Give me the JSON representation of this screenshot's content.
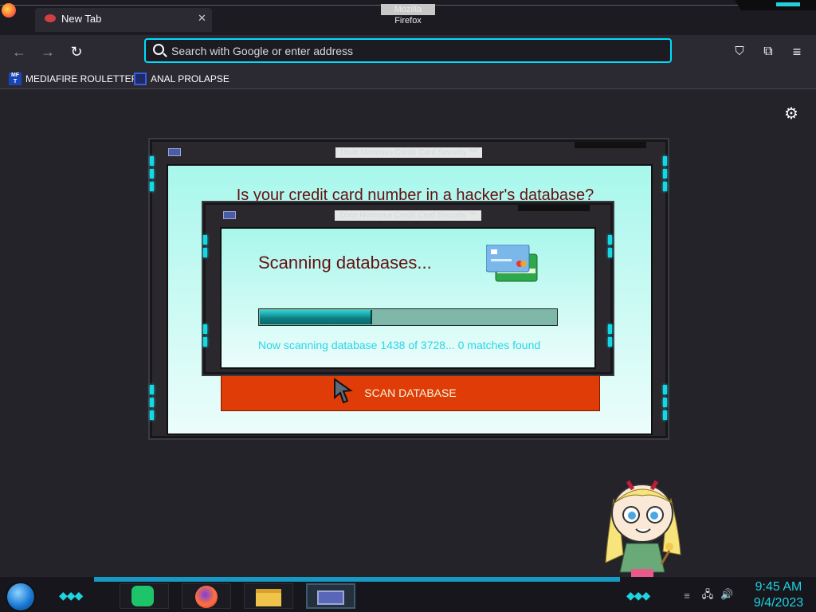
{
  "browser": {
    "window_title": "Mozilla Firefox",
    "tab_title": "New Tab",
    "url_placeholder": "Search with Google or enter address",
    "bookmarks": [
      {
        "label": "MEDIAFIRE ROULETTER",
        "icon": "mediafire-icon"
      },
      {
        "label": "ANAL PROLAPSE",
        "icon": "bookmark-page-icon"
      }
    ]
  },
  "main_window": {
    "title": "Dixie Normous Credit Card Security ™",
    "headline": "Is your credit card number in a hacker's database?",
    "scan_button_label": "SCAN DATABASE"
  },
  "scan_dialog": {
    "title": "Dixie Normous Credit Card Security ™",
    "heading": "Scanning databases...",
    "progress": 0.38,
    "status": "Now scanning database 1438 of 3728... 0 matches found"
  },
  "taskbar": {
    "time": "9:45 AM",
    "date": "9/4/2023"
  },
  "colors": {
    "accent": "#14d8e6",
    "panel": "#a8f7ec",
    "headline": "#661010",
    "scan_button": "#e03c08"
  }
}
